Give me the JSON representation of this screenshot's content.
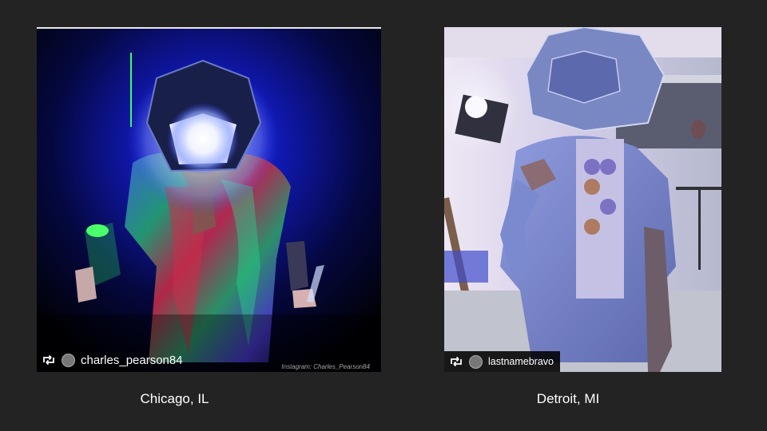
{
  "slide": {
    "background": "#232323"
  },
  "photos": [
    {
      "repost_username": "charles_pearson84",
      "watermark": "Instagram: Charles_Pearson84",
      "caption": "Chicago, IL",
      "icons": [
        "repost-icon",
        "avatar"
      ]
    },
    {
      "repost_username": "lastnamebravo",
      "caption": "Detroit, MI",
      "icons": [
        "repost-icon",
        "avatar"
      ]
    }
  ]
}
